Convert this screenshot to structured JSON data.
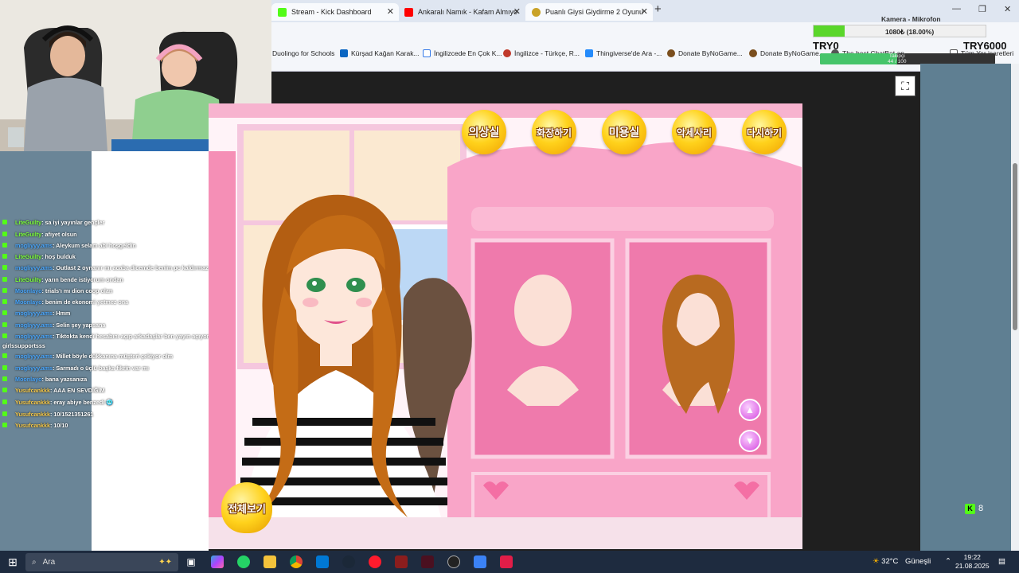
{
  "browser": {
    "tabs": [
      {
        "label": "Stream - Kick Dashboard",
        "icon": "kick-icon",
        "color": "#53fc18"
      },
      {
        "label": "Ankaralı Namık - Kafam Almıyo",
        "icon": "youtube-icon",
        "color": "#ff0000"
      },
      {
        "label": "Puanlı Giysi Giydirme 2 Oyunu",
        "icon": "game-site-icon",
        "color": "#c9a227"
      }
    ],
    "bookmarks": [
      {
        "label": "Duolingo for Schools"
      },
      {
        "label": "Kürşad Kağan Karak..."
      },
      {
        "label": "İngilizcede En Çok K..."
      },
      {
        "label": "İngilizce - Türkçe, R..."
      },
      {
        "label": "Thingiverse'de Ara -..."
      },
      {
        "label": "Donate ByNoGame..."
      },
      {
        "label": "Donate ByNoGame..."
      },
      {
        "label": "The best ChatBot ap..."
      },
      {
        "label": "Tüm Yer işaretleri"
      }
    ]
  },
  "overlay": {
    "camera_label": "Kamera - Mikrofon",
    "goal_text": "1080₺ (18.00%)",
    "goal_fraction": 0.18,
    "left_amount": "TRY0",
    "right_amount": "TRY6000",
    "follow_label": "Takipçi",
    "follow_count": "44 / 100",
    "follow_fraction": 0.44
  },
  "chat": [
    {
      "user": "LiteGuilty",
      "msg": ": sa iyi yayınlar gençler",
      "cls": "n-green"
    },
    {
      "user": "LiteGuilty",
      "msg": ": afiyet olsun",
      "cls": "n-green"
    },
    {
      "user": "mogliyyy.ams",
      "msg": ": Aleykum selam abi hoşgeldin",
      "cls": "n-blue"
    },
    {
      "user": "LiteGuilty",
      "msg": ": hoş bulduk",
      "cls": "n-green"
    },
    {
      "user": "mogliyyy.ams",
      "msg": ": Outlast 2 oynanır mı acaba dicemde benim pc kaldırmaz",
      "cls": "n-blue"
    },
    {
      "user": "LiteGuilty",
      "msg": ": yarın bende istiyorum ondan",
      "cls": "n-green"
    },
    {
      "user": "Moonlayo",
      "msg": ": trials'ı mı dion coop olan",
      "cls": "n-blue"
    },
    {
      "user": "Moonlayo",
      "msg": ": benim de ekonomi yetmez ona",
      "cls": "n-blue"
    },
    {
      "user": "mogliyyy.ams",
      "msg": ": Hmm",
      "cls": "n-blue"
    },
    {
      "user": "mogliyyy.ams",
      "msg": ": Selin şey yapsana",
      "cls": "n-blue"
    },
    {
      "user": "mogliyyy.ams",
      "msg": ": Tiktokta kendi hesabını açıp arkadaşlar ben yayın açıyorum ama hiç kimse gelmiyor",
      "cls": "n-blue"
    },
    {
      "user": "",
      "msg": "girlssupportsss",
      "cls": "n-blue"
    },
    {
      "user": "mogliyyy.ams",
      "msg": ": Millet böyle dükkanına müşteri çekiyor olm",
      "cls": "n-blue"
    },
    {
      "user": "mogliyyy.ams",
      "msg": ": Sarmadı o üçlü başka fikrin var mı",
      "cls": "n-blue"
    },
    {
      "user": "Moonlayo",
      "msg": ": bana yazsanıza",
      "cls": "n-blue"
    },
    {
      "user": "Yusufcankkk",
      "msg": ": AAA EN SEVDİĞİM",
      "cls": "n-yellow"
    },
    {
      "user": "Yusufcankkk",
      "msg": ": eray abiye benzedi 🥶",
      "cls": "n-yellow"
    },
    {
      "user": "Yusufcankkk",
      "msg": ": 10/1521351261",
      "cls": "n-yellow"
    },
    {
      "user": "Yusufcankkk",
      "msg": ": 10/10",
      "cls": "n-yellow"
    }
  ],
  "game": {
    "menu": [
      "의상실",
      "화장하기",
      "미용실",
      "악세사리",
      "다시하기"
    ],
    "view_all": "전체보기"
  },
  "kick": {
    "count": "8"
  },
  "taskbar": {
    "search_placeholder": "Ara",
    "weather": "32°C",
    "weather_desc": "Güneşli",
    "time": "19:22",
    "date": "21.08.2025"
  }
}
